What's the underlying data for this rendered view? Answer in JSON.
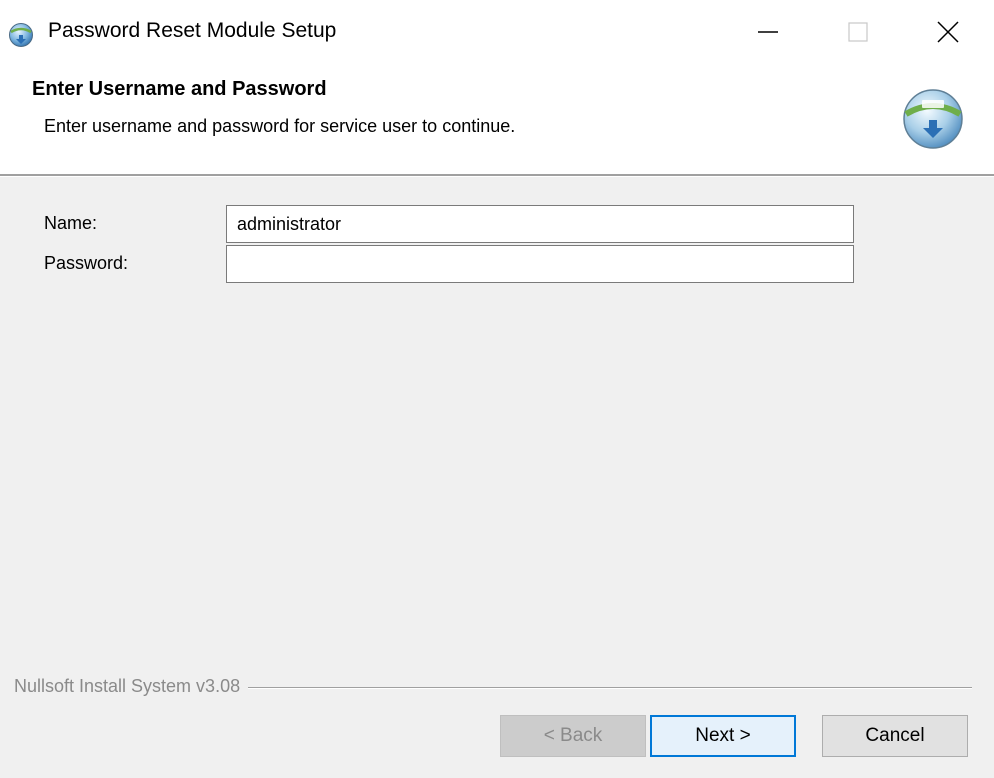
{
  "window": {
    "title": "Password Reset Module Setup",
    "app_icon": "installer-globe-icon",
    "controls": {
      "minimize_icon": "minimize-icon",
      "maximize_icon": "maximize-icon",
      "close_icon": "close-icon"
    }
  },
  "header": {
    "title": "Enter Username and Password",
    "subtitle": "Enter username and password for service user to continue.",
    "icon": "nsis-installer-icon"
  },
  "form": {
    "name_label": "Name:",
    "name_value": "administrator",
    "password_label": "Password:",
    "password_value": ""
  },
  "footer": {
    "branding": "Nullsoft Install System v3.08",
    "back_label": "< Back",
    "back_enabled": false,
    "next_label": "Next >",
    "cancel_label": "Cancel"
  },
  "colors": {
    "focus_accent": "#0078d7",
    "dialog_background": "#f0f0f0",
    "header_background": "#ffffff",
    "disabled_text": "#8a8a8a"
  }
}
